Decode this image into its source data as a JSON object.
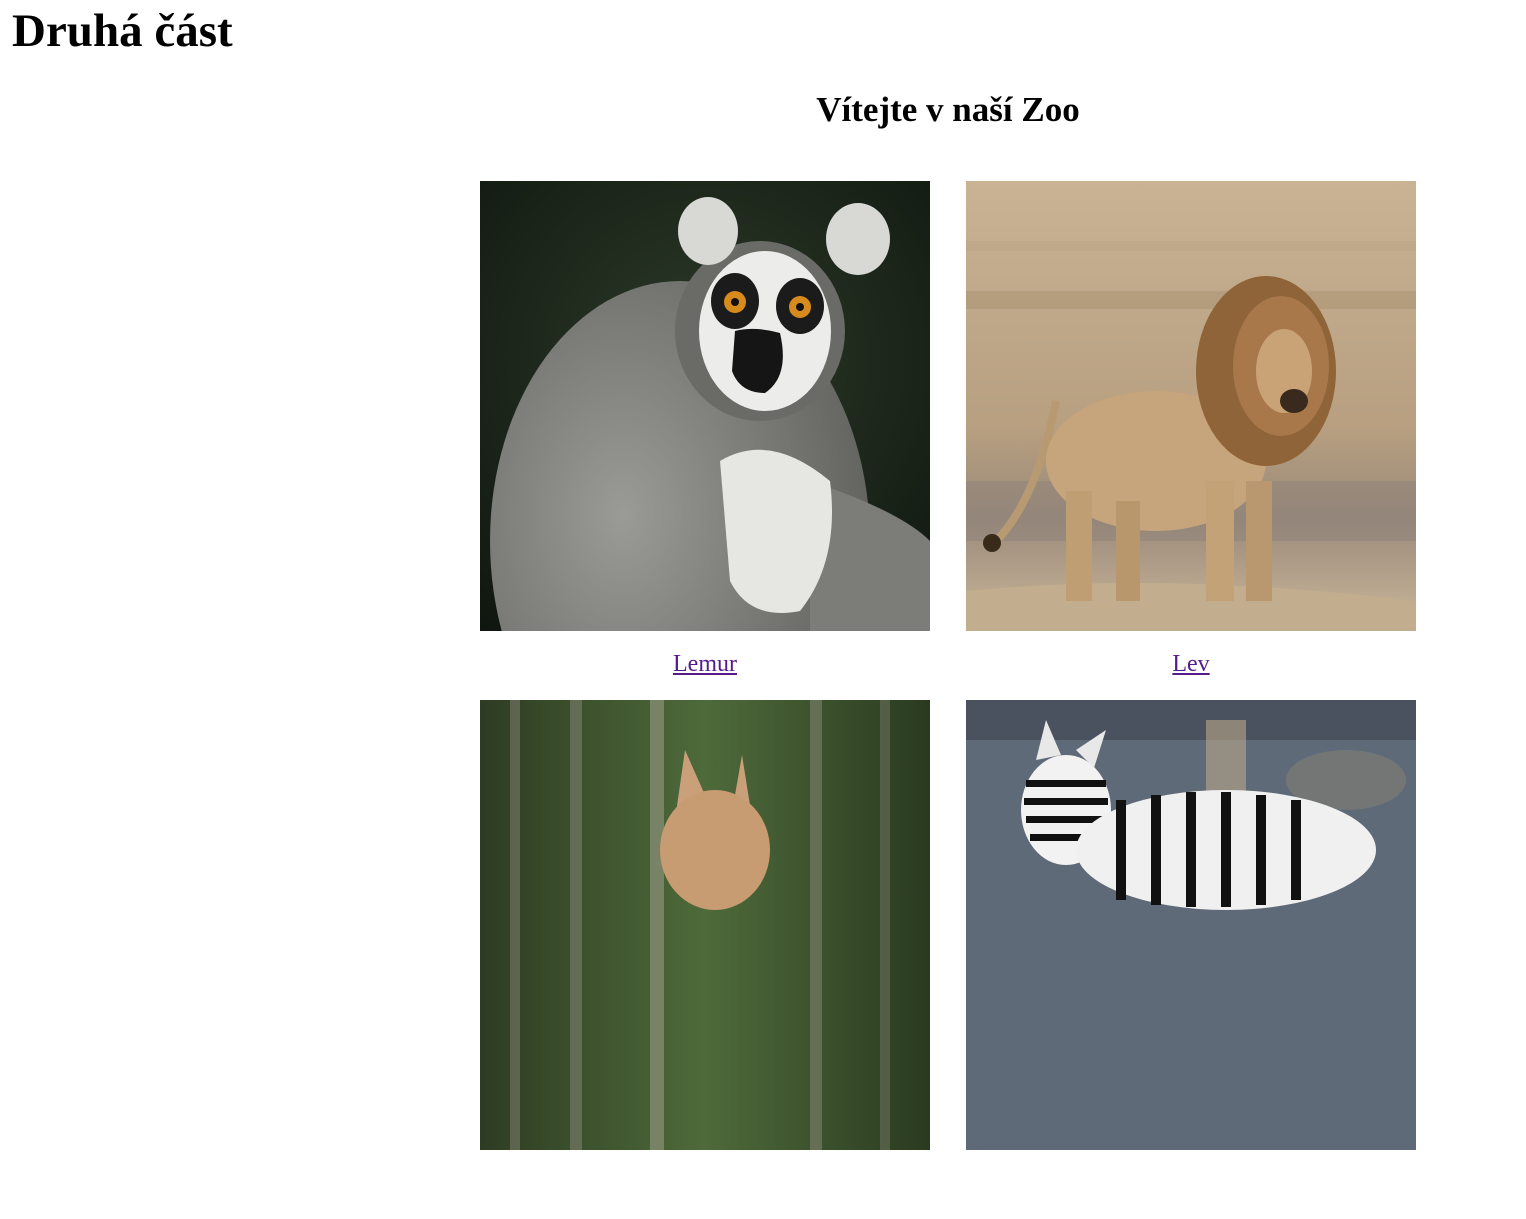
{
  "page": {
    "title": "Druhá část"
  },
  "zoo": {
    "heading": "Vítejte v naší Zoo",
    "animals": [
      {
        "label": "Lemur"
      },
      {
        "label": "Lev"
      },
      {
        "label": ""
      },
      {
        "label": ""
      }
    ]
  },
  "colors": {
    "link_visited": "#551a8b",
    "background": "#ffffff",
    "text": "#000000"
  }
}
